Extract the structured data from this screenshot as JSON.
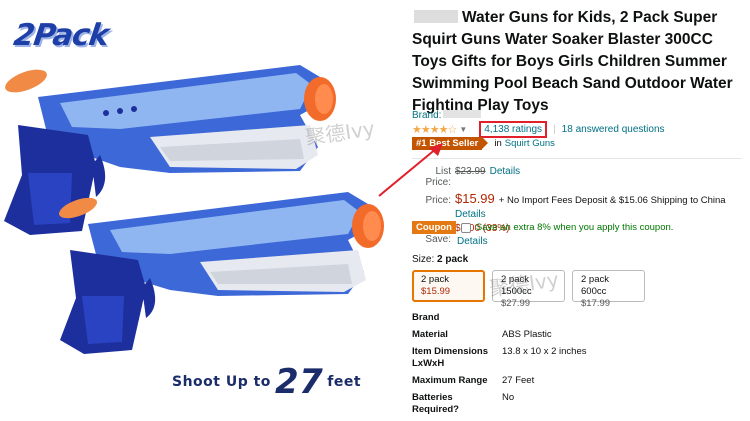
{
  "image": {
    "pack_badge": "2Pack",
    "shoot_prefix": "Shoot Up to",
    "shoot_number": "27",
    "shoot_suffix": "feet",
    "watermark": "聚德Ivy"
  },
  "product": {
    "title": "Water Guns for Kids, 2 Pack Super Squirt Guns Water Soaker Blaster 300CC Toys Gifts for Boys Girls Children Summer Swimming Pool Beach Sand Outdoor Water Fighting Play Toys",
    "brand_label": "Brand:",
    "stars": "★★★★☆",
    "ratings": "4,138 ratings",
    "answered": "18 answered questions",
    "bestseller_badge": "#1 Best Seller",
    "bestseller_in": "in",
    "bestseller_category": "Squirt Guns"
  },
  "pricing": {
    "list_label": "List Price:",
    "list_price": "$23.99",
    "list_details": "Details",
    "price_label": "Price:",
    "price": "$15.99",
    "price_note": "+ No Import Fees Deposit & $15.06 Shipping to China",
    "price_details": "Details",
    "save_label": "You Save:",
    "save_value": "$8.00 (33%)"
  },
  "coupon": {
    "badge": "Coupon",
    "text": "Save an extra 8% when you apply this coupon.",
    "details": "Details"
  },
  "size": {
    "label": "Size:",
    "selected": "2 pack",
    "options": [
      {
        "name": "2 pack",
        "price": "$15.99"
      },
      {
        "name": "2 pack 1500cc",
        "price": "$27.99"
      },
      {
        "name": "2 pack 600cc",
        "price": "$17.99"
      }
    ]
  },
  "attributes": [
    {
      "key": "Brand",
      "value": ""
    },
    {
      "key": "Material",
      "value": "ABS Plastic"
    },
    {
      "key": "Item Dimensions LxWxH",
      "value": "13.8 x 10 x 2 inches"
    },
    {
      "key": "Maximum Range",
      "value": "27 Feet"
    },
    {
      "key": "Batteries Required?",
      "value": "No"
    }
  ],
  "colors": {
    "link": "#007185",
    "price": "#b12704",
    "bestseller": "#c45500",
    "coupon": "#e47911",
    "selected_border": "#e77600",
    "annotation": "#e0202a"
  }
}
